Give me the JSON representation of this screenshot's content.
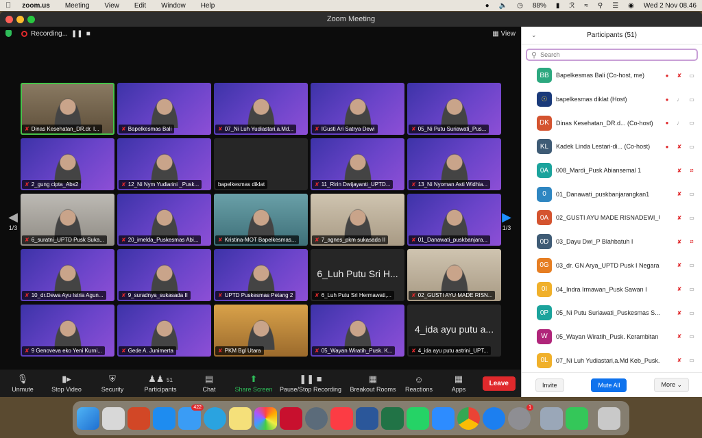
{
  "menubar": {
    "app": "zoom.us",
    "items": [
      "Meeting",
      "View",
      "Edit",
      "Window",
      "Help"
    ],
    "battery": "88%",
    "datetime": "Wed 2 Nov  08.46"
  },
  "window": {
    "title": "Zoom Meeting"
  },
  "meeting": {
    "recording": "Recording...",
    "view": "View",
    "page_left": "1/3",
    "page_right": "1/3"
  },
  "tiles": [
    {
      "label": "Dinas Kesehatan_DR.dr. I...",
      "style": "room",
      "active": true
    },
    {
      "label": "Bapelkesmas Bali",
      "style": "banner"
    },
    {
      "label": "07_Ni Luh Yudiastari,a.Md...",
      "style": "banner"
    },
    {
      "label": "IGusti Ari Satrya Dewi",
      "style": "banner"
    },
    {
      "label": "05_Ni Putu Suriawati_Pus...",
      "style": "banner"
    },
    {
      "label": "2_gung cipta_Abs2",
      "style": "banner"
    },
    {
      "label": "12_Ni Nym Yudiarini _Pusk...",
      "style": "banner"
    },
    {
      "label": "bapelkesmas diklat",
      "style": "dark",
      "nomic": true
    },
    {
      "label": "11_Ririn Dwijayanti_UPTD...",
      "style": "banner"
    },
    {
      "label": "13_Ni Nyoman Asti Widhia...",
      "style": "banner"
    },
    {
      "label": "6_suratni_UPTD Pusk Suka...",
      "style": "grey"
    },
    {
      "label": "20_imelda_Puskesmas Abi...",
      "style": "banner"
    },
    {
      "label": "Kristina-MOT Bapelkesmas...",
      "style": "teal"
    },
    {
      "label": "7_agnes_pkm sukasada II",
      "style": "wall"
    },
    {
      "label": "01_Danawati_puskbanjara...",
      "style": "banner"
    },
    {
      "label": "10_dr.Dewa Ayu Istria Agun...",
      "style": "banner"
    },
    {
      "label": "9_suradnya_sukasada II",
      "style": "banner"
    },
    {
      "label": "UPTD Puskesmas Petang 2",
      "style": "banner"
    },
    {
      "label": "6_Luh Putu Sri Hermawati,...",
      "style": "dark",
      "bigname": "6_Luh Putu Sri H..."
    },
    {
      "label": "02_GUSTI AYU MADE RISN...",
      "style": "wall"
    },
    {
      "label": "9 Genoveva eko Yeni Kurni...",
      "style": "banner"
    },
    {
      "label": "Gede A. Junimerta",
      "style": "banner"
    },
    {
      "label": "PKM Bgl Utara",
      "style": "warm"
    },
    {
      "label": "05_Wayan Wiratih_Pusk. K...",
      "style": "banner"
    },
    {
      "label": "4_ida ayu putu astrini_UPT...",
      "style": "dark",
      "bigname": "4_ida ayu putu a..."
    }
  ],
  "toolbar": {
    "unmute": "Unmute",
    "stop_video": "Stop Video",
    "security": "Security",
    "participants": "Participants",
    "participants_count": "51",
    "chat": "Chat",
    "share": "Share Screen",
    "pause_rec": "Pause/Stop Recording",
    "breakout": "Breakout Rooms",
    "reactions": "Reactions",
    "apps": "Apps",
    "leave": "Leave"
  },
  "panel": {
    "title": "Participants (51)",
    "search_placeholder": "Search",
    "participants": [
      {
        "initials": "BB",
        "color": "#2ca87f",
        "name": "Bapelkesmas Bali (Co-host, me)",
        "rec": true,
        "mic": "off",
        "video": "on"
      },
      {
        "initials": "",
        "color": "#1a3a7a",
        "name": "bapelkesmas diklat (Host)",
        "rec": true,
        "mic": "on",
        "video": "on",
        "logo": true
      },
      {
        "initials": "DK",
        "color": "#d4532f",
        "name": "Dinas Kesehatan_DR.d... (Co-host)",
        "rec": true,
        "mic": "on",
        "video": "on"
      },
      {
        "initials": "KL",
        "color": "#3e5b75",
        "name": "Kadek Linda Lestari-di... (Co-host)",
        "rec": true,
        "mic": "off",
        "video": "on"
      },
      {
        "initials": "0A",
        "color": "#1ba39c",
        "name": "008_Mardi_Pusk Abiansemal 1",
        "rec": false,
        "mic": "off",
        "video": "off"
      },
      {
        "initials": "0",
        "color": "#2e86c1",
        "name": "01_Danawati_puskbanjarangkan1",
        "rec": false,
        "mic": "off",
        "video": "on"
      },
      {
        "initials": "0A",
        "color": "#d4532f",
        "name": "02_GUSTI AYU MADE RISNADEWI_U...",
        "rec": false,
        "mic": "off",
        "video": "on"
      },
      {
        "initials": "0D",
        "color": "#3e5b75",
        "name": "03_Dayu Dwi_P Blahbatuh I",
        "rec": false,
        "mic": "off",
        "video": "off"
      },
      {
        "initials": "0G",
        "color": "#e67e22",
        "name": "03_dr. GN Arya_UPTD Pusk I Negara",
        "rec": false,
        "mic": "off",
        "video": "on"
      },
      {
        "initials": "0I",
        "color": "#f0b02a",
        "name": "04_Indra Irmawan_Pusk Sawan I",
        "rec": false,
        "mic": "off",
        "video": "on"
      },
      {
        "initials": "0P",
        "color": "#1ba39c",
        "name": "05_Ni Putu Suriawati_Puskesmas S...",
        "rec": false,
        "mic": "off",
        "video": "on"
      },
      {
        "initials": "W",
        "color": "#b0257a",
        "name": "05_Wayan Wiratih_Pusk. Kerambitan II",
        "rec": false,
        "mic": "off",
        "video": "on"
      },
      {
        "initials": "0L",
        "color": "#f0b02a",
        "name": "07_Ni Luh Yudiastari,a.Md Keb_Pusk....",
        "rec": false,
        "mic": "off",
        "video": "on"
      }
    ],
    "invite": "Invite",
    "mute_all": "Mute All",
    "more": "More"
  },
  "dock": {
    "mail_badge": "422",
    "settings_badge": "1"
  }
}
